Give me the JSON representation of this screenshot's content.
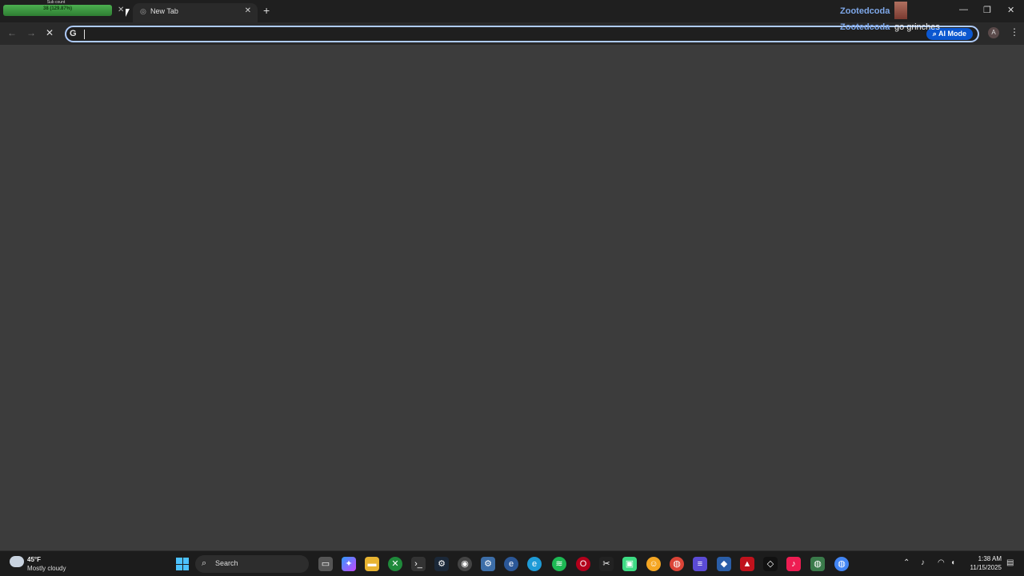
{
  "browser": {
    "tabs": [
      {
        "label": "Sub count",
        "bar_text": "38 (129.87%)",
        "active": false
      },
      {
        "label": "New Tab",
        "active": true
      }
    ],
    "window_controls": {
      "minimize": "—",
      "maximize": "❐",
      "close": "✕"
    },
    "address_bar": {
      "value": "",
      "g_label": "G",
      "ai_mode_label": "AI Mode"
    },
    "profile_initial": "A"
  },
  "overlay": {
    "name_top": "Zootedcoda",
    "name_chat": "Zootedcoda",
    "chat_message": "go grinches"
  },
  "taskbar": {
    "weather": {
      "temp": "45°F",
      "condition": "Mostly cloudy"
    },
    "search_label": "Search",
    "clock": {
      "time": "1:38 AM",
      "date": "11/15/2025"
    },
    "apps": [
      "copilot-icon",
      "file-explorer-icon",
      "xbox-icon",
      "terminal-icon",
      "steam-icon",
      "obs-icon",
      "settings-icon",
      "edge-icon",
      "edge-dev-icon",
      "spotify-icon",
      "opera-icon",
      "capcut-icon",
      "android-icon",
      "discord-icon",
      "chrome-icon",
      "notes-icon",
      "vscode-icon",
      "apex-icon",
      "unity-icon",
      "tiktok-icon",
      "chrome-alt-icon",
      "chrome-active-icon"
    ]
  },
  "colors": {
    "accent": "#aecbfa",
    "ai_mode": "#0b57d0",
    "progress": "#4caf50",
    "chat_name": "#7ea7e8"
  }
}
